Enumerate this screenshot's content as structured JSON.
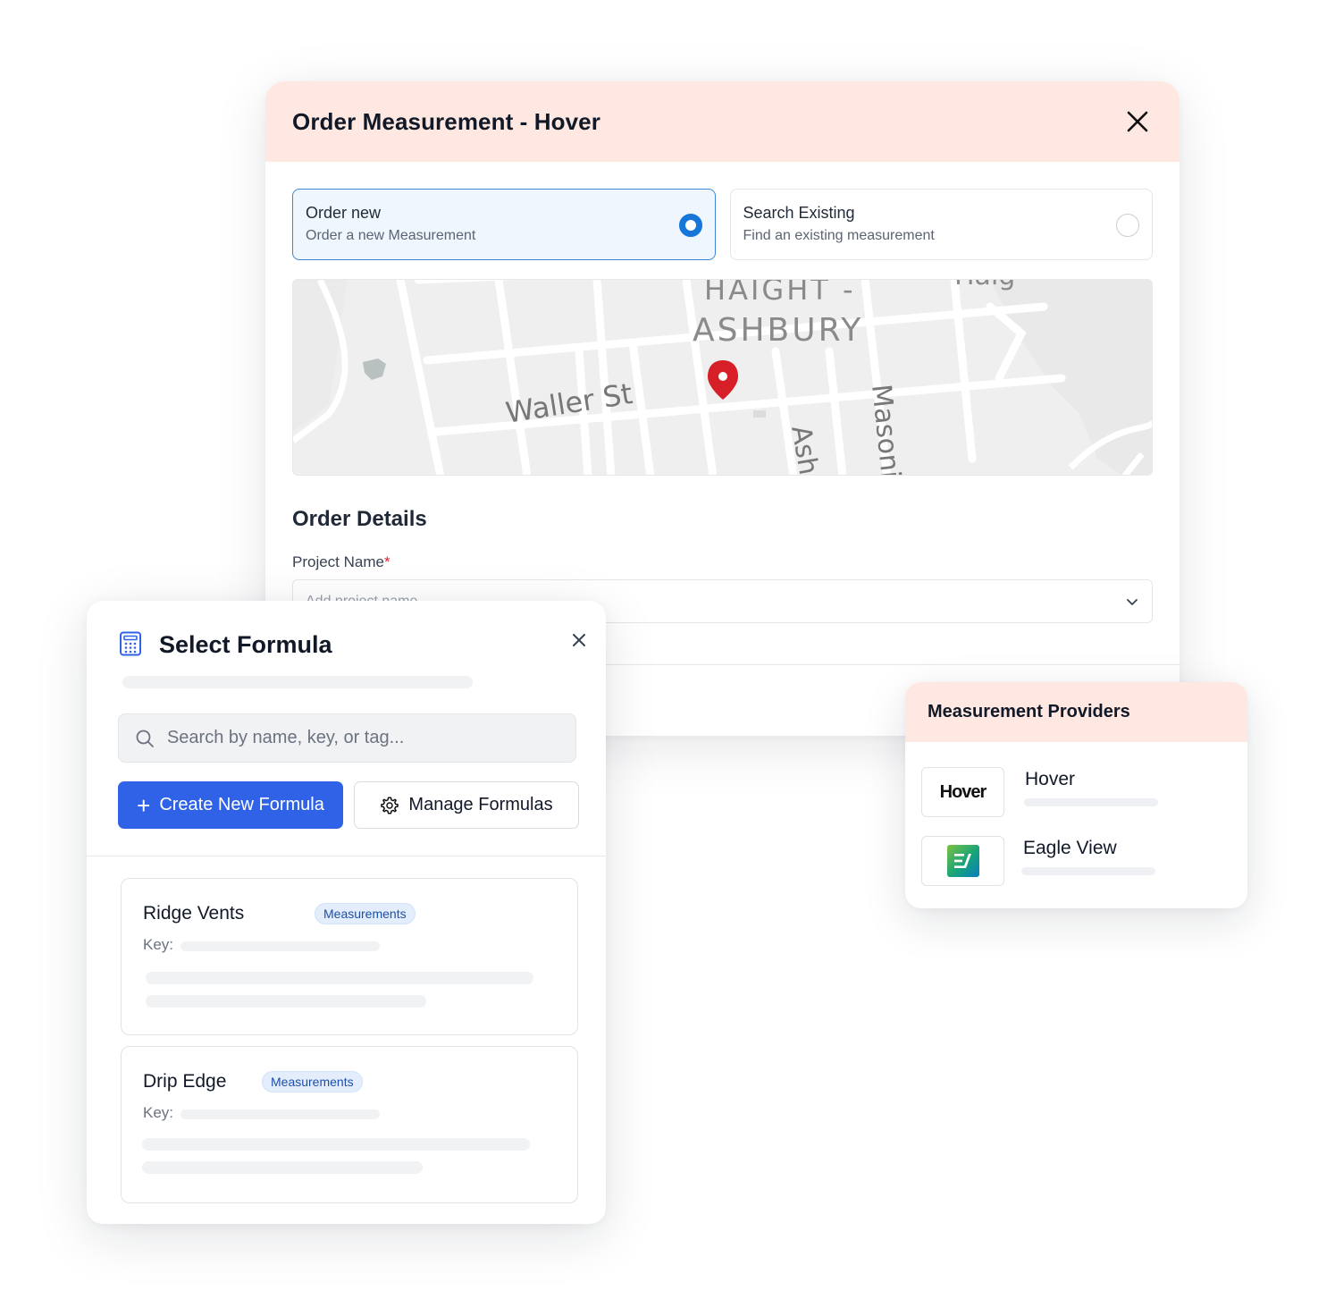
{
  "order_modal": {
    "title": "Order Measurement - Hover",
    "options": [
      {
        "title": "Order new",
        "subtitle": "Order a new Measurement",
        "selected": true
      },
      {
        "title": "Search Existing",
        "subtitle": "Find an existing measurement",
        "selected": false
      }
    ],
    "map": {
      "labels": {
        "district_line1": "HAIGHT -",
        "district_line2": "ASHBURY",
        "street_waller": "Waller St",
        "street_ashbury": "Ash",
        "street_masonic": "Masoni",
        "top_right": "Haig"
      },
      "pin_color": "#d61f26"
    },
    "details_title": "Order Details",
    "project_label": "Project Name",
    "required_mark": "*",
    "project_placeholder": "Add project name"
  },
  "formula_panel": {
    "title": "Select Formula",
    "search_placeholder": "Search by name, key, or tag...",
    "create_button": "Create New Formula",
    "manage_button": "Manage Formulas",
    "formulas": [
      {
        "name": "Ridge Vents",
        "tag": "Measurements",
        "key_label": "Key:"
      },
      {
        "name": "Drip Edge",
        "tag": "Measurements",
        "key_label": "Key:"
      }
    ]
  },
  "providers": {
    "title": "Measurement Providers",
    "items": [
      {
        "name": "Hover",
        "logo_text": "Hover"
      },
      {
        "name": "Eagle View",
        "logo_icon": "eagleview-logo-icon"
      }
    ]
  },
  "colors": {
    "accent": "#2f62e6",
    "header_tint": "#fee8e1",
    "radio_selected": "#1677d9",
    "tag_bg": "#e3edfc"
  }
}
